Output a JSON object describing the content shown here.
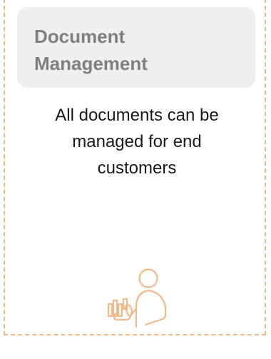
{
  "card": {
    "title": "Document\nManagement",
    "description": "All documents can be\nmanaged for end\ncustomers",
    "icon": "person-with-chart-icon"
  },
  "colors": {
    "accent": "#f2b98a",
    "title_text": "#7f7f7f",
    "title_background": "#efefef",
    "body_text": "#1a1a1a"
  }
}
